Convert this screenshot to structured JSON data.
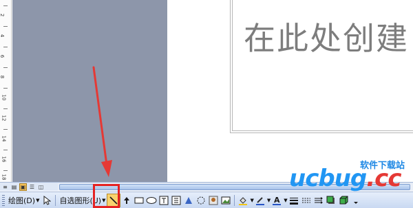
{
  "ruler": {
    "numbers": [
      "2",
      "4",
      "6",
      "8",
      "10",
      "12",
      "14",
      "16",
      "18"
    ]
  },
  "slide": {
    "placeholder_text": "在此处创建"
  },
  "toolbar": {
    "draw_label": "绘图(D)",
    "autoshapes_label": "自选图形(U)"
  },
  "watermark": {
    "tagline": "软件下载站",
    "logo_main": "ucbug",
    "logo_dot": ".",
    "logo_cc": "cc"
  },
  "colors": {
    "highlight": "#e52222",
    "arrow": "#e53935",
    "pasteboard": "#8d96aa"
  }
}
